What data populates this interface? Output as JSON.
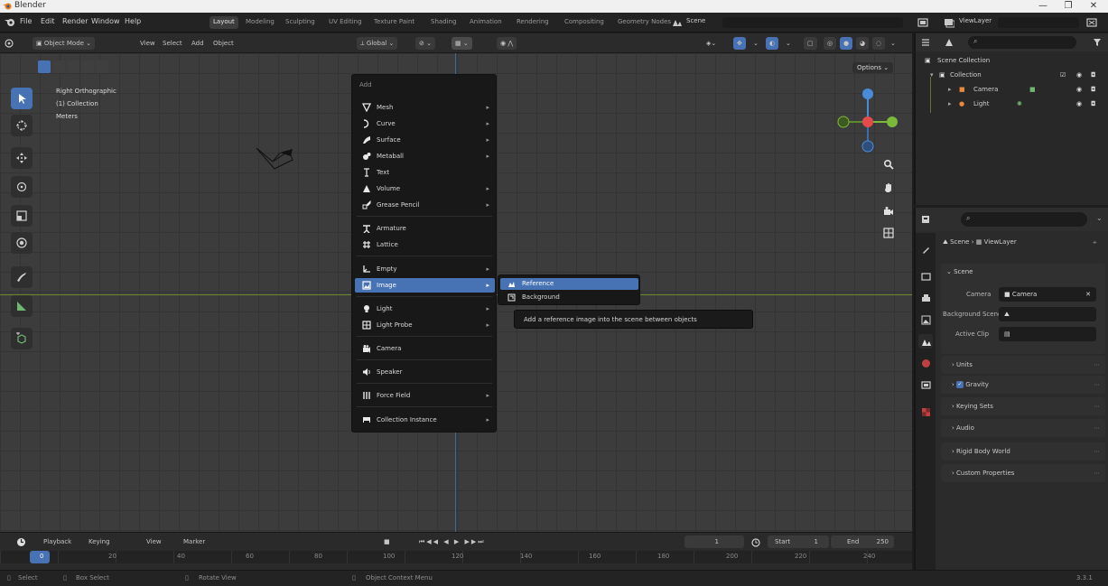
{
  "window": {
    "title": "Blender",
    "buttons": [
      "—",
      "❐",
      "✕"
    ]
  },
  "topbar": {
    "menus": [
      "File",
      "Edit",
      "Render",
      "Window",
      "Help"
    ],
    "workspaces": [
      "Layout",
      "Modeling",
      "Sculpting",
      "UV Editing",
      "Texture Paint",
      "Shading",
      "Animation",
      "Rendering",
      "Compositing",
      "Geometry Nodes"
    ],
    "active_workspace": "Layout",
    "scene_name": "Scene",
    "view_layer": "ViewLayer"
  },
  "viewport_header": {
    "mode": "Object Mode",
    "menus": [
      "View",
      "Select",
      "Add",
      "Object"
    ],
    "transform_orientation": "Global",
    "options_label": "Options"
  },
  "viewport": {
    "view_name": "Right Orthographic",
    "collection": "(1) Collection",
    "units": "Meters"
  },
  "add_menu": {
    "title": "Add",
    "items": [
      {
        "label": "Mesh",
        "icon": "mesh-icon",
        "has_submenu": true
      },
      {
        "label": "Curve",
        "icon": "curve-icon",
        "has_submenu": true
      },
      {
        "label": "Surface",
        "icon": "surface-icon",
        "has_submenu": true
      },
      {
        "label": "Metaball",
        "icon": "metaball-icon",
        "has_submenu": true
      },
      {
        "label": "Text",
        "icon": "text-icon",
        "has_submenu": false
      },
      {
        "label": "Volume",
        "icon": "volume-icon",
        "has_submenu": true
      },
      {
        "label": "Grease Pencil",
        "icon": "grease-pencil-icon",
        "has_submenu": true
      },
      {
        "label": "Armature",
        "icon": "armature-icon",
        "has_submenu": false
      },
      {
        "label": "Lattice",
        "icon": "lattice-icon",
        "has_submenu": false
      },
      {
        "label": "Empty",
        "icon": "empty-icon",
        "has_submenu": true
      },
      {
        "label": "Image",
        "icon": "image-icon",
        "has_submenu": true
      },
      {
        "label": "Light",
        "icon": "light-icon",
        "has_submenu": true
      },
      {
        "label": "Light Probe",
        "icon": "light-probe-icon",
        "has_submenu": true
      },
      {
        "label": "Camera",
        "icon": "camera-icon",
        "has_submenu": false
      },
      {
        "label": "Speaker",
        "icon": "speaker-icon",
        "has_submenu": false
      },
      {
        "label": "Force Field",
        "icon": "force-field-icon",
        "has_submenu": true
      },
      {
        "label": "Collection Instance",
        "icon": "collection-instance-icon",
        "has_submenu": true
      }
    ],
    "highlighted": "Image"
  },
  "image_submenu": {
    "items": [
      "Reference",
      "Background"
    ],
    "highlighted": "Reference",
    "tooltip": "Add a reference image into the scene between objects"
  },
  "timeline": {
    "menus": [
      "Playback",
      "Keying",
      "View",
      "Marker"
    ],
    "current_frame": "1",
    "start_label": "Start",
    "start": "1",
    "end_label": "End",
    "end": "250",
    "ticks": [
      "0",
      "20",
      "40",
      "60",
      "80",
      "100",
      "120",
      "140",
      "160",
      "180",
      "200",
      "220",
      "240"
    ]
  },
  "statusbar": {
    "items": [
      "Select",
      "Box Select",
      "Rotate View",
      "Object Context Menu"
    ],
    "version": "3.3.1"
  },
  "outliner": {
    "rows": [
      "Scene Collection",
      "Collection",
      "Camera",
      "Light"
    ]
  },
  "properties": {
    "breadcrumb_scene": "Scene",
    "breadcrumb_viewlayer": "ViewLayer",
    "panel_title": "Scene",
    "fields": [
      {
        "label": "Camera",
        "value": "Camera"
      },
      {
        "label": "Background Scene",
        "value": ""
      },
      {
        "label": "Active Clip",
        "value": ""
      }
    ],
    "panels": [
      "Units",
      "Gravity",
      "Keying Sets",
      "Audio",
      "Rigid Body World",
      "Custom Properties"
    ],
    "gravity_checked": true
  },
  "colors": {
    "accent": "#4772b3",
    "x_axis": "#e54b4b",
    "y_axis": "#7cb83a",
    "z_axis": "#4a8bd9"
  }
}
